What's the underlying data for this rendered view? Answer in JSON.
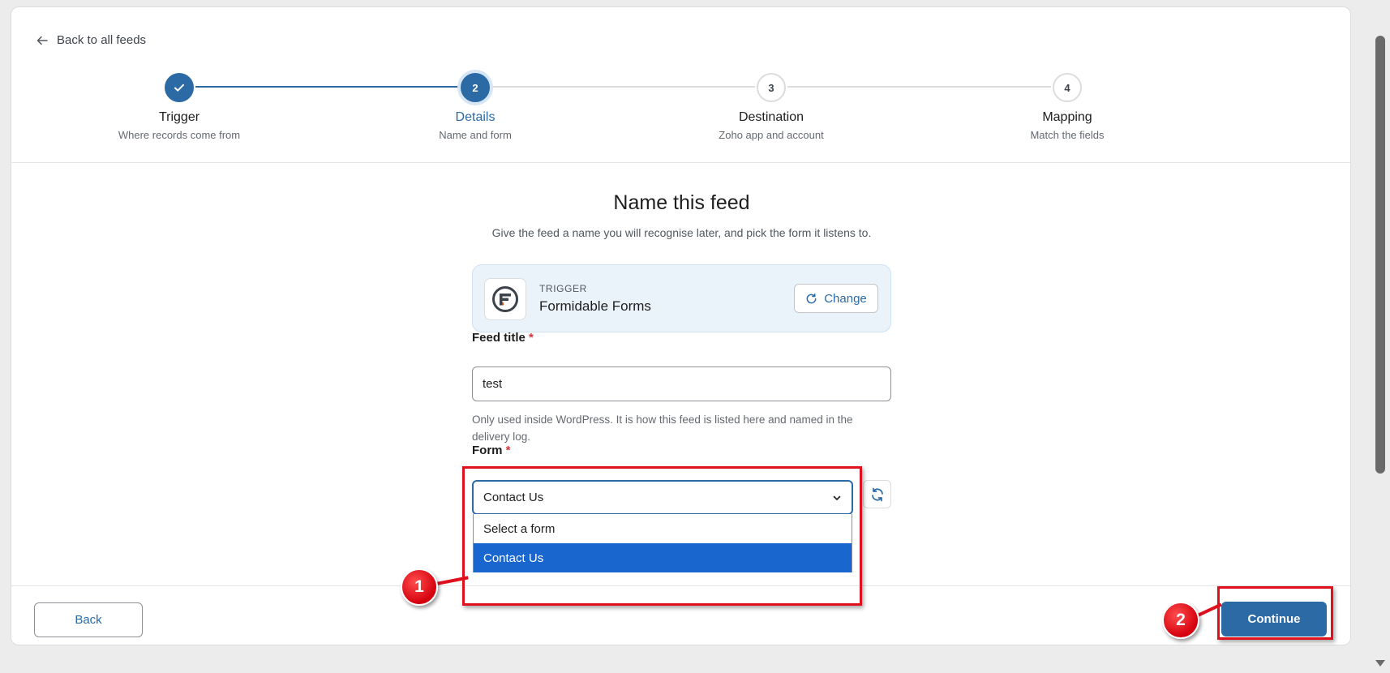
{
  "nav": {
    "back_label": "Back to all feeds"
  },
  "steps": [
    {
      "number": "1",
      "title": "Trigger",
      "subtitle": "Where records come from",
      "state": "done"
    },
    {
      "number": "2",
      "title": "Details",
      "subtitle": "Name and form",
      "state": "active"
    },
    {
      "number": "3",
      "title": "Destination",
      "subtitle": "Zoho app and account",
      "state": "pending"
    },
    {
      "number": "4",
      "title": "Mapping",
      "subtitle": "Match the fields",
      "state": "pending"
    }
  ],
  "main": {
    "heading": "Name this feed",
    "subheading": "Give the feed a name you will recognise later, and pick the form it listens to."
  },
  "trigger": {
    "kicker": "TRIGGER",
    "name": "Formidable Forms",
    "change_label": "Change"
  },
  "feed_title": {
    "label": "Feed title",
    "required_mark": "*",
    "value": "test",
    "help": "Only used inside WordPress. It is how this feed is listed here and named in the delivery log."
  },
  "form_field": {
    "label": "Form",
    "required_mark": "*",
    "selected": "Contact Us",
    "options": [
      "Select a form",
      "Contact Us"
    ]
  },
  "footer": {
    "back_label": "Back",
    "continue_label": "Continue"
  },
  "annotations": {
    "marker_1": "1",
    "marker_2": "2"
  },
  "colors": {
    "accent": "#2c6aa6",
    "highlight": "#e0101d",
    "selected_option": "#1a66cf"
  }
}
